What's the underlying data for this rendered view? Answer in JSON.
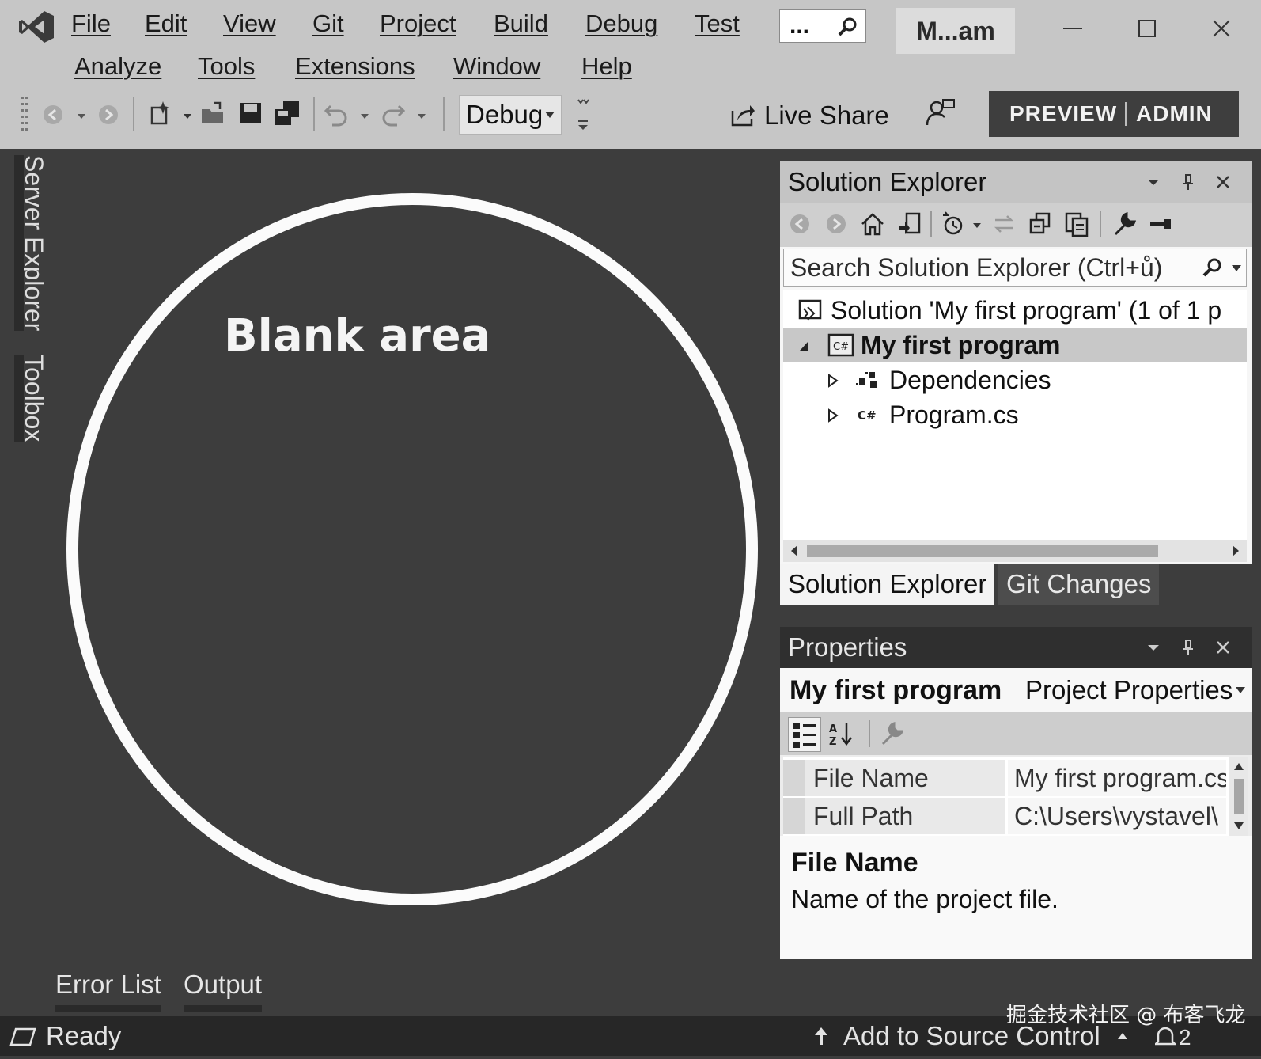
{
  "title_bar": {
    "menu_row1": [
      "File",
      "Edit",
      "View",
      "Git",
      "Project",
      "Build",
      "Debug",
      "Test"
    ],
    "menu_row2": [
      "Analyze",
      "Tools",
      "Extensions",
      "Window",
      "Help"
    ],
    "search_text": "...",
    "solution_name": "M...am",
    "window_controls": [
      "minimize-icon",
      "maximize-icon",
      "close-icon"
    ]
  },
  "toolbar": {
    "config": "Debug",
    "live_share": "Live Share",
    "preview": "PREVIEW",
    "admin": "ADMIN"
  },
  "side_tabs": [
    "Server Explorer",
    "Toolbox"
  ],
  "editor": {
    "blank_label": "Blank area"
  },
  "solution_explorer": {
    "title": "Solution Explorer",
    "search_placeholder": "Search Solution Explorer (Ctrl+ů)",
    "tree": [
      {
        "label": "Solution 'My first program' (1 of 1 p",
        "icon": "solution-icon",
        "selected": false
      },
      {
        "label": "My first program",
        "icon": "csharp-project-icon",
        "selected": true,
        "expanded": true
      },
      {
        "label": "Dependencies",
        "icon": "dependencies-icon",
        "selected": false
      },
      {
        "label": "Program.cs",
        "icon": "csharp-file-icon",
        "selected": false
      }
    ],
    "tabs": [
      "Solution Explorer",
      "Git Changes"
    ],
    "active_tab": "Solution Explorer"
  },
  "properties": {
    "title": "Properties",
    "object_name": "My first program",
    "object_type": "Project Properties",
    "rows": [
      {
        "name": "File Name",
        "value": "My first program.csproj"
      },
      {
        "name": "Full Path",
        "value": "C:\\Users\\vystavel\\"
      }
    ],
    "desc_title": "File Name",
    "desc_text": "Name of the project file."
  },
  "bottom_tabs": [
    "Error List",
    "Output"
  ],
  "status": {
    "text": "Ready",
    "source_control": "Add to Source Control",
    "notifications": "2"
  },
  "watermark": "掘金技术社区 @ 布客飞龙",
  "colors": {
    "chrome": "#c6c6c6",
    "editor_bg": "#3d3d3d",
    "status_bg": "#272727",
    "selection": "#c8c8c8"
  }
}
